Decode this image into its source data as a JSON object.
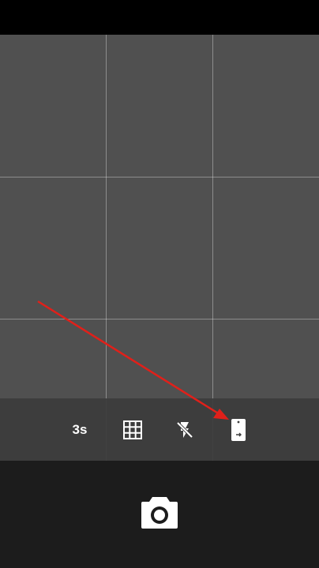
{
  "quick_settings": {
    "timer_label": "3s",
    "timer_icon": "timer-icon",
    "grid_icon": "grid-icon",
    "flash_icon": "flash-off-icon",
    "orientation_icon": "phone-orientation-icon"
  },
  "shutter": {
    "icon": "camera-shutter-icon"
  },
  "colors": {
    "viewfinder": "#505050",
    "quick_settings_bg": "#3c3c3c",
    "shutter_bar_bg": "#1c1c1c",
    "annotation_arrow": "#e0201a"
  }
}
